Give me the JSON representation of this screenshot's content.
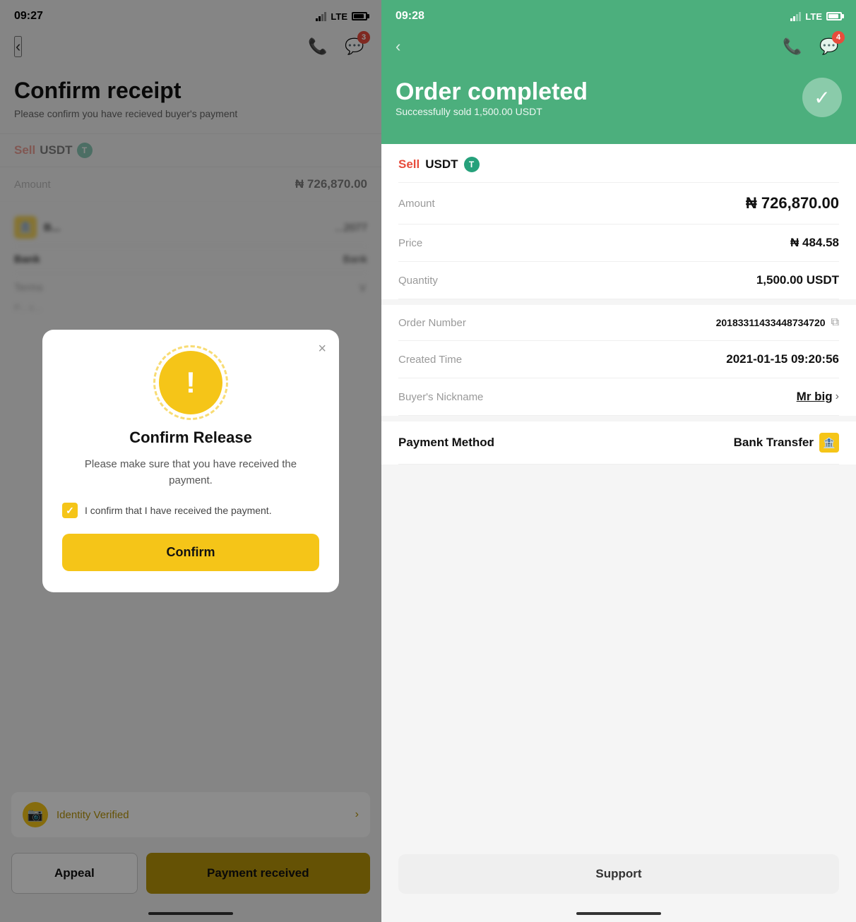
{
  "left": {
    "status_time": "09:27",
    "nav_back": "‹",
    "page_title": "Confirm receipt",
    "page_subtitle": "Please confirm you have recieved buyer's payment",
    "sell_label": "Sell",
    "coin": "USDT",
    "amount_label": "Amount",
    "amount_value": "₦ 726,870.00",
    "blurred_rows": [
      {
        "label": "Bank",
        "value": "...2077"
      },
      {
        "label": "Bank",
        "value": "Bank"
      }
    ],
    "terms_label": "Terms",
    "identity_verified": "Identity Verified",
    "appeal_btn": "Appeal",
    "payment_received_btn": "Payment received",
    "modal": {
      "title": "Confirm Release",
      "desc": "Please make sure that you have received the payment.",
      "checkbox_label": "I confirm that I have received the payment.",
      "confirm_btn": "Confirm",
      "close": "×"
    },
    "chat_badge": "3"
  },
  "right": {
    "status_time": "09:28",
    "order_title": "Order completed",
    "order_subtitle": "Successfully sold 1,500.00 USDT",
    "sell_label": "Sell",
    "coin": "USDT",
    "amount_label": "Amount",
    "amount_value": "₦ 726,870.00",
    "price_label": "Price",
    "price_value": "₦ 484.58",
    "quantity_label": "Quantity",
    "quantity_value": "1,500.00 USDT",
    "order_number_label": "Order Number",
    "order_number_value": "20183311433448734720",
    "created_time_label": "Created Time",
    "created_time_value": "2021-01-15 09:20:56",
    "buyer_label": "Buyer's Nickname",
    "buyer_value": "Mr big",
    "payment_method_label": "Payment Method",
    "payment_method_value": "Bank Transfer",
    "support_btn": "Support",
    "chat_badge": "4"
  }
}
